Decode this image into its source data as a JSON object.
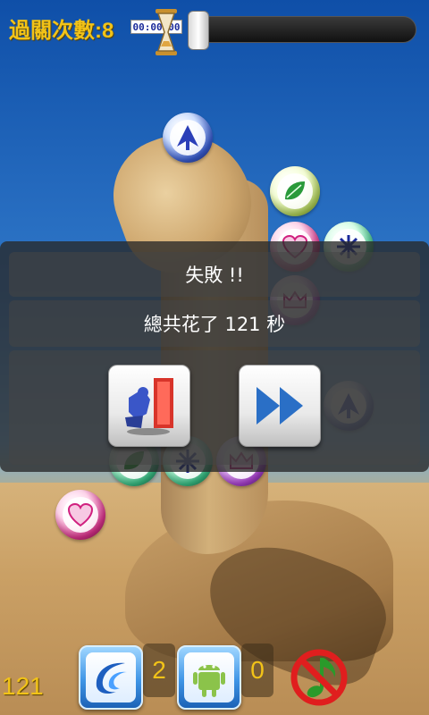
{
  "hud": {
    "level_label": "過關次數:8",
    "timer": "00:00:00",
    "progress_fraction": 0.0
  },
  "dialog": {
    "title": "失敗 !!",
    "message": "總共花了 121 秒",
    "exit_icon": "exit-door-icon",
    "next_icon": "fast-forward-icon"
  },
  "bottom": {
    "score": "121",
    "wave_count": "2",
    "android_count": "0",
    "wave_icon": "wave-icon",
    "android_icon": "android-robot-icon",
    "mute_icon": "music-off-icon"
  },
  "colors": {
    "hud_yellow": "#f2c318",
    "bubble_blue": "#3a5fd6",
    "bubble_pink": "#e0338f",
    "bubble_green": "#3cc58a",
    "bubble_purple": "#b044d6"
  }
}
